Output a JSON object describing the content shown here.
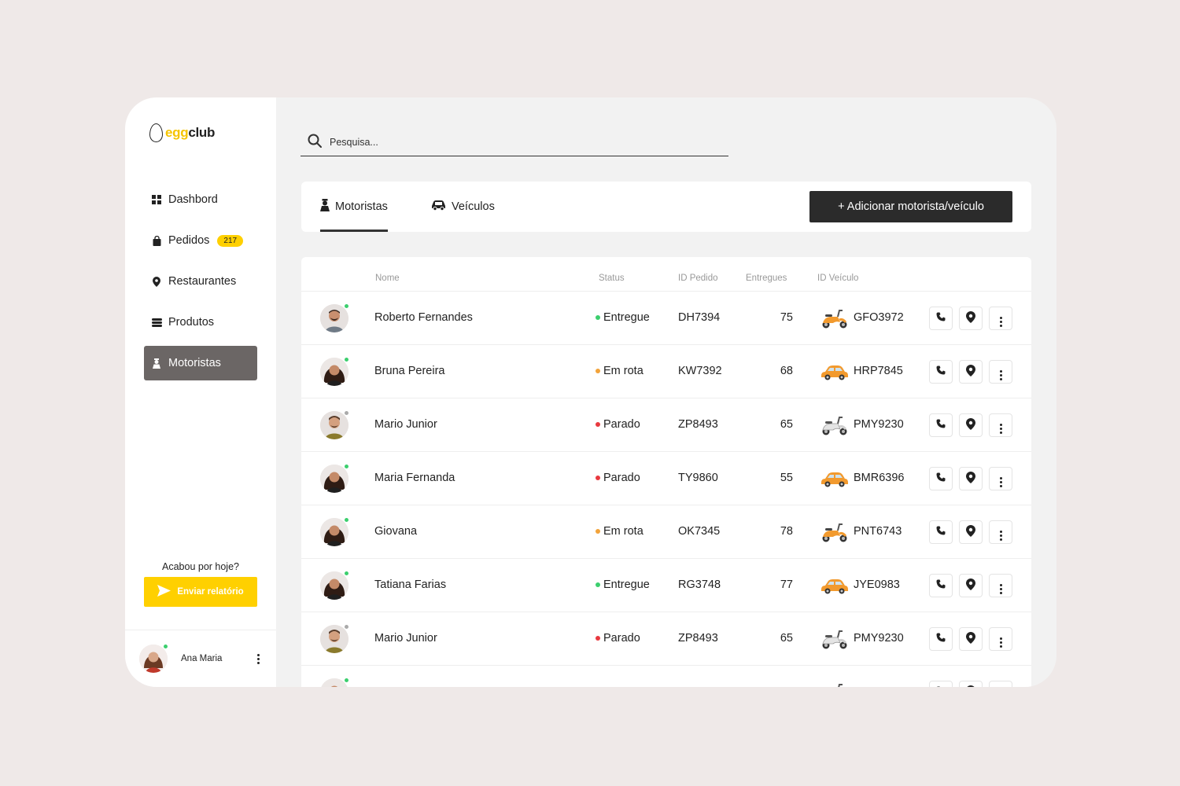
{
  "brand": {
    "egg": "egg",
    "club": "club"
  },
  "colors": {
    "accent": "#ffd000",
    "online": "#3ccf6e",
    "offline": "#aaaaaa",
    "delivered": "#3ccf6e",
    "enroute": "#f2a33a",
    "stopped": "#e8393f",
    "active_nav": "#6b6665"
  },
  "nav": [
    {
      "label": "Dashbord",
      "icon": "grid-icon"
    },
    {
      "label": "Pedidos",
      "icon": "bag-icon",
      "badge": "217"
    },
    {
      "label": "Restaurantes",
      "icon": "pin-icon"
    },
    {
      "label": "Produtos",
      "icon": "layers-icon"
    },
    {
      "label": "Motoristas",
      "icon": "driver-icon",
      "active": true
    }
  ],
  "report": {
    "question": "Acabou por hoje?",
    "button": "Enviar relatório"
  },
  "user": {
    "name": "Ana Maria"
  },
  "search": {
    "placeholder": "Pesquisa..."
  },
  "tabs": [
    {
      "label": "Motoristas",
      "icon": "driver-icon",
      "active": true
    },
    {
      "label": "Veículos",
      "icon": "car-icon"
    }
  ],
  "add_button": "+ Adicionar motorista/veículo",
  "table": {
    "headers": {
      "name": "Nome",
      "status": "Status",
      "order": "ID Pedido",
      "delivered": "Entregues",
      "vehicle": "ID Veículo"
    },
    "rows": [
      {
        "name": "Roberto Fernandes",
        "status": "Entregue",
        "status_key": "delivered",
        "order": "DH7394",
        "delivered": "75",
        "vehicle_type": "scooter-orange",
        "vehicle_id": "GFO3972",
        "online": true,
        "avatar": "man"
      },
      {
        "name": "Bruna Pereira",
        "status": "Em rota",
        "status_key": "enroute",
        "order": "KW7392",
        "delivered": "68",
        "vehicle_type": "car-orange",
        "vehicle_id": "HRP7845",
        "online": true,
        "avatar": "woman"
      },
      {
        "name": "Mario Junior",
        "status": "Parado",
        "status_key": "stopped",
        "order": "ZP8493",
        "delivered": "65",
        "vehicle_type": "scooter-white",
        "vehicle_id": "PMY9230",
        "online": false,
        "avatar": "man2"
      },
      {
        "name": "Maria Fernanda",
        "status": "Parado",
        "status_key": "stopped",
        "order": "TY9860",
        "delivered": "55",
        "vehicle_type": "car-orange",
        "vehicle_id": "BMR6396",
        "online": true,
        "avatar": "woman"
      },
      {
        "name": "Giovana",
        "status": "Em rota",
        "status_key": "enroute",
        "order": "OK7345",
        "delivered": "78",
        "vehicle_type": "scooter-orange",
        "vehicle_id": "PNT6743",
        "online": true,
        "avatar": "woman"
      },
      {
        "name": "Tatiana Farias",
        "status": "Entregue",
        "status_key": "delivered",
        "order": "RG3748",
        "delivered": "77",
        "vehicle_type": "car-orange",
        "vehicle_id": "JYE0983",
        "online": true,
        "avatar": "woman"
      },
      {
        "name": "Mario Junior",
        "status": "Parado",
        "status_key": "stopped",
        "order": "ZP8493",
        "delivered": "65",
        "vehicle_type": "scooter-white",
        "vehicle_id": "PMY9230",
        "online": false,
        "avatar": "man2"
      },
      {
        "name": "",
        "status": "",
        "status_key": "",
        "order": "",
        "delivered": "",
        "vehicle_type": "scooter-white",
        "vehicle_id": "",
        "online": true,
        "avatar": "woman"
      }
    ]
  }
}
